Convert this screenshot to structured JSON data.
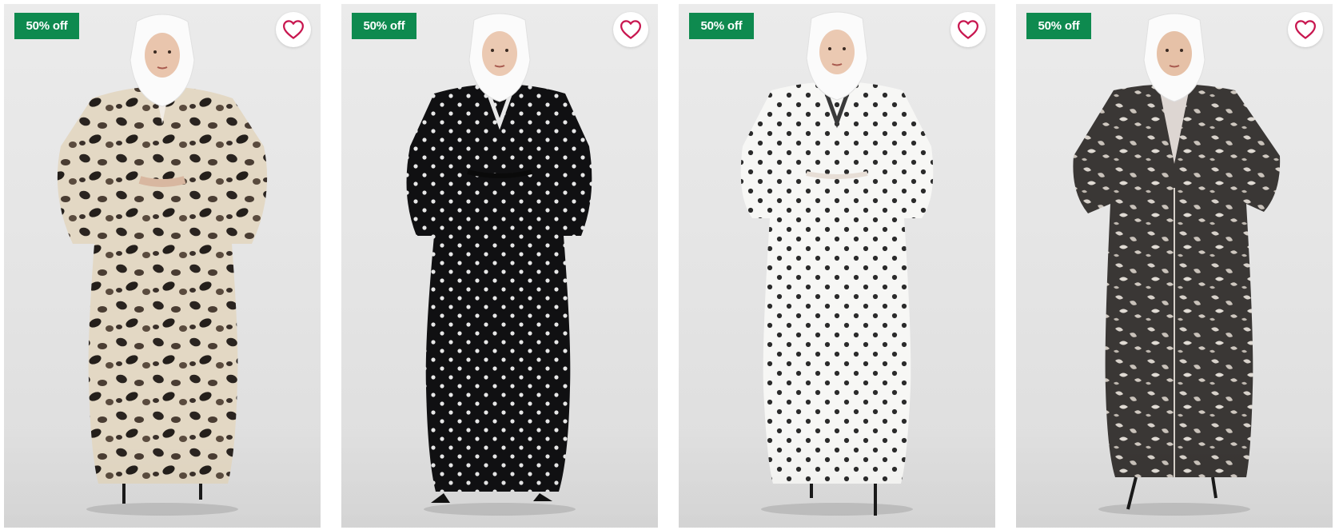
{
  "accent": {
    "badge_bg": "#0e8a4f",
    "heart": "#c8164f"
  },
  "products": [
    {
      "badge": "50% off",
      "wishlist_icon": "heart-outline-icon",
      "pattern": "leopard"
    },
    {
      "badge": "50% off",
      "wishlist_icon": "heart-outline-icon",
      "pattern": "black-polka"
    },
    {
      "badge": "50% off",
      "wishlist_icon": "heart-outline-icon",
      "pattern": "white-polka"
    },
    {
      "badge": "50% off",
      "wishlist_icon": "heart-outline-icon",
      "pattern": "abstract-print"
    }
  ]
}
